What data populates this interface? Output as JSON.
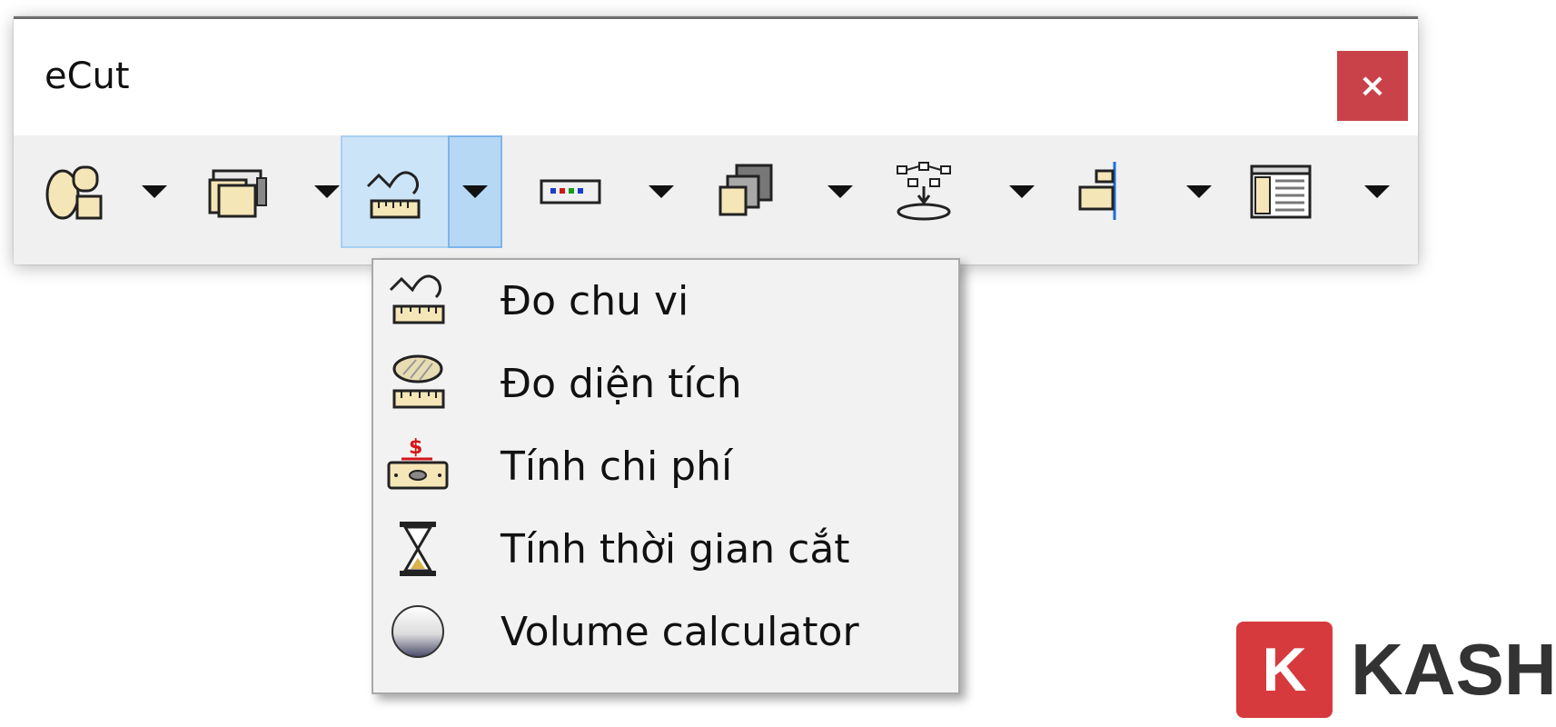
{
  "window": {
    "title": "eCut",
    "close_label": "×"
  },
  "toolbar": {
    "tools": [
      {
        "icon": "shapes-icon"
      },
      {
        "icon": "copy-print-icon"
      },
      {
        "icon": "measure-icon",
        "active": true
      },
      {
        "icon": "color-bar-icon"
      },
      {
        "icon": "layers-icon"
      },
      {
        "icon": "flowchart-icon"
      },
      {
        "icon": "align-icon"
      },
      {
        "icon": "table-icon"
      }
    ]
  },
  "dropdown_menu": {
    "items": [
      {
        "label": "Đo chu vi",
        "icon": "perimeter-ruler-icon"
      },
      {
        "label": "Đo diện tích",
        "icon": "area-ruler-icon"
      },
      {
        "label": "Tính chi phí",
        "icon": "cost-icon"
      },
      {
        "label": "Tính thời gian cắt",
        "icon": "hourglass-icon"
      },
      {
        "label": "Volume calculator",
        "icon": "sphere-icon"
      }
    ]
  },
  "watermark": {
    "badge": "K",
    "text": "KASHI",
    "color": "#d63a3d"
  },
  "colors": {
    "close": "#c9424a",
    "highlight": "#cce4f7",
    "menu_bg": "#f2f2f2"
  }
}
